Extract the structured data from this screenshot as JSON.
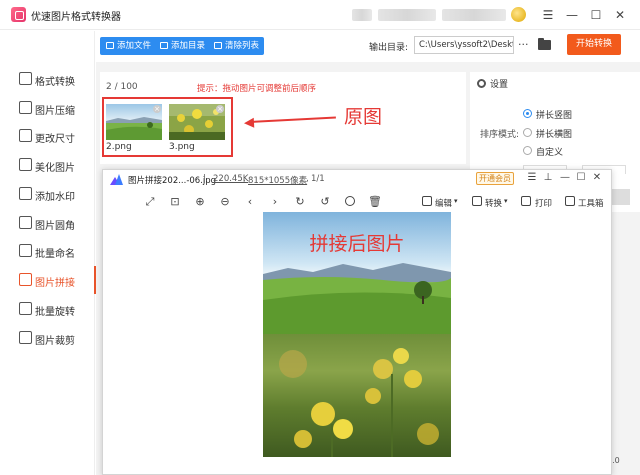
{
  "app": {
    "title": "优速图片格式转换器",
    "window_controls": [
      "☰",
      "—",
      "☐",
      "✕"
    ]
  },
  "sidebar": {
    "items": [
      {
        "label": "格式转换",
        "icon": "convert-icon"
      },
      {
        "label": "图片压缩",
        "icon": "compress-icon"
      },
      {
        "label": "更改尺寸",
        "icon": "resize-icon"
      },
      {
        "label": "美化图片",
        "icon": "beautify-icon"
      },
      {
        "label": "添加水印",
        "icon": "watermark-icon"
      },
      {
        "label": "图片圆角",
        "icon": "round-corner-icon"
      },
      {
        "label": "批量命名",
        "icon": "rename-icon"
      },
      {
        "label": "图片拼接",
        "icon": "stitch-icon",
        "active": true
      },
      {
        "label": "批量旋转",
        "icon": "rotate-icon"
      },
      {
        "label": "图片裁剪",
        "icon": "crop-icon"
      }
    ],
    "active_color": "#e8542b"
  },
  "toolbar": {
    "add_file": "添加文件",
    "add_folder": "添加目录",
    "clear_list": "清除列表",
    "output_label": "输出目录:",
    "output_path": "C:\\Users\\yssoft2\\Deskt",
    "more": "···",
    "start": "开始转换",
    "accent": "#2d8cf0",
    "start_color": "#f25a1c"
  },
  "file_list": {
    "count": "2 / 100",
    "hint": "提示：拖动图片可调整前后顺序",
    "files": [
      {
        "name": "2.png"
      },
      {
        "name": "3.png"
      }
    ],
    "annotation": "原图"
  },
  "settings": {
    "title": "设置",
    "sort_label": "排序模式:",
    "options": [
      {
        "label": "拼长竖图",
        "selected": true
      },
      {
        "label": "拼长横图",
        "selected": false
      },
      {
        "label": "自定义",
        "selected": false
      }
    ]
  },
  "viewer": {
    "filename": "图片拼接202...-06.jpg",
    "size": "220.45K",
    "dimensions": "815*1055像素",
    "page": "1/1",
    "vip": "开通会员",
    "tools": {
      "edit": "编辑",
      "convert": "转换",
      "print": "打印",
      "toolbox": "工具箱"
    },
    "window_controls": [
      "☰",
      "⊥",
      "☐",
      "✕"
    ],
    "image_caption": "拼接后图片"
  },
  "version": "5.0"
}
